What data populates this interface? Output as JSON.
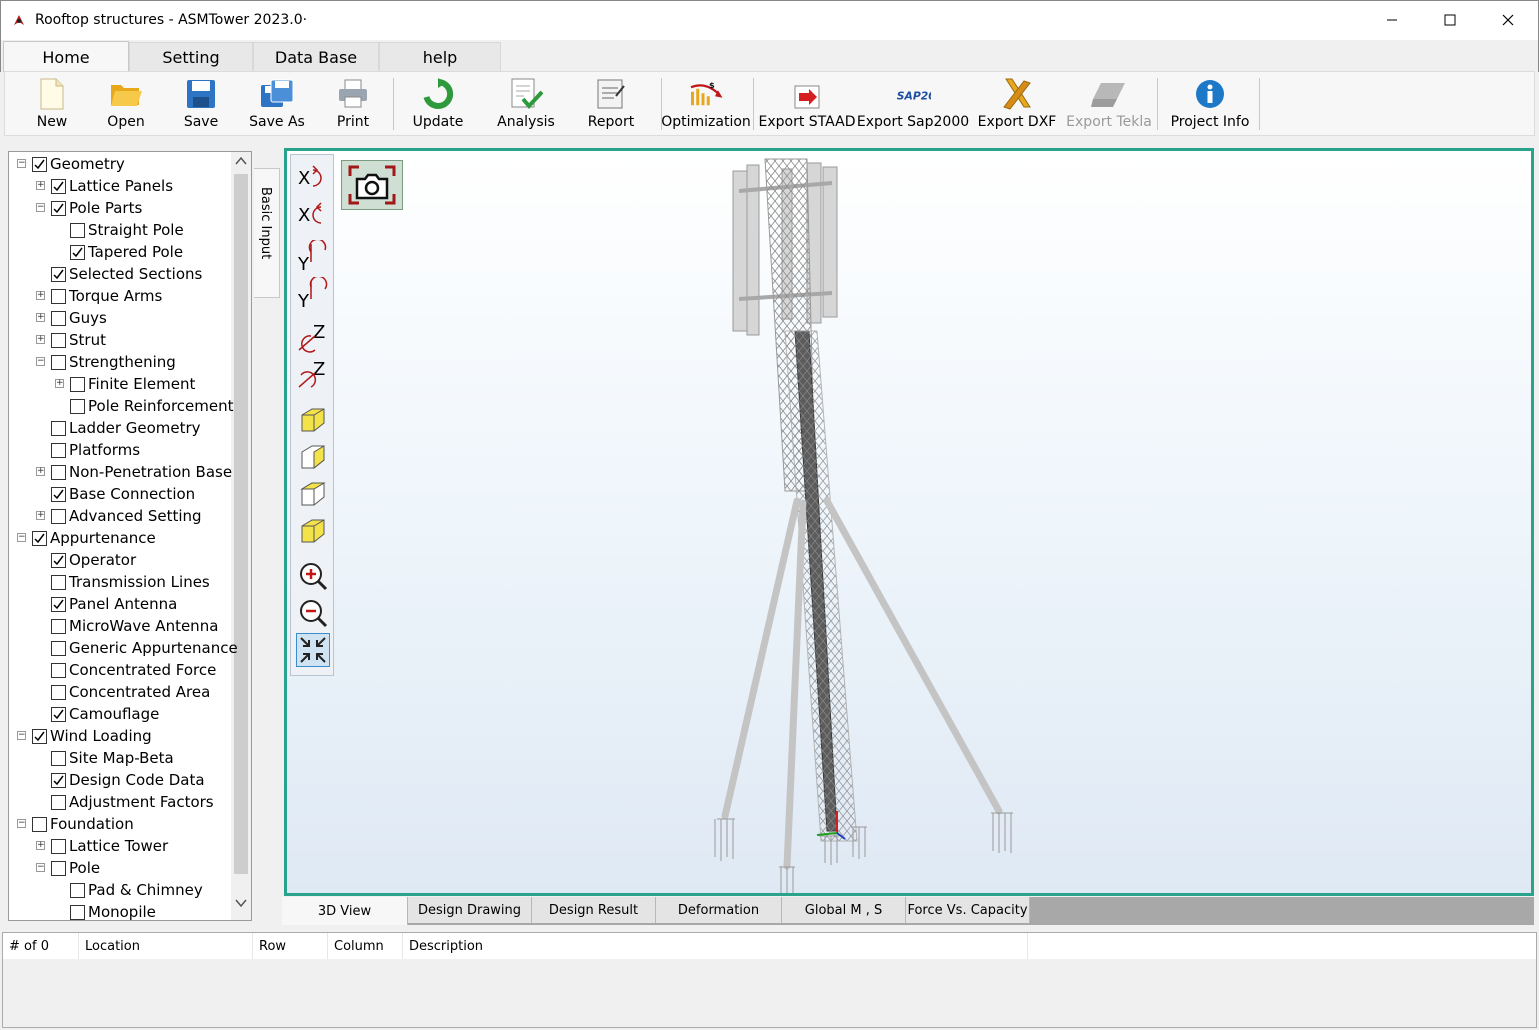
{
  "window": {
    "title": "Rooftop structures - ASMTower 2023.0·"
  },
  "tabs": [
    {
      "label": "Home",
      "active": true
    },
    {
      "label": "Setting"
    },
    {
      "label": "Data Base"
    },
    {
      "label": "help"
    }
  ],
  "ribbon": {
    "new": "New",
    "open": "Open",
    "save": "Save",
    "save_as": "Save As",
    "print": "Print",
    "update": "Update",
    "analysis": "Analysis",
    "report": "Report",
    "optimization": "Optimization",
    "export_staad": "Export STAAD",
    "export_sap": "Export Sap2000",
    "export_dxf": "Export DXF",
    "export_tekla": "Export Tekla",
    "project_info": "Project Info",
    "sap_logo_text": "SAP2000"
  },
  "side_tab": "Basic Input",
  "tree": [
    {
      "label": "Geometry",
      "checked": true,
      "exp": "-"
    },
    {
      "label": "Lattice Panels",
      "checked": true,
      "exp": "+"
    },
    {
      "label": "Pole Parts",
      "checked": true,
      "exp": "-"
    },
    {
      "label": "Straight Pole",
      "checked": false
    },
    {
      "label": "Tapered Pole",
      "checked": true
    },
    {
      "label": "Selected Sections",
      "checked": true
    },
    {
      "label": "Torque Arms",
      "checked": false,
      "exp": "+"
    },
    {
      "label": "Guys",
      "checked": false,
      "exp": "+"
    },
    {
      "label": "Strut",
      "checked": false,
      "exp": "+"
    },
    {
      "label": "Strengthening",
      "checked": false,
      "exp": "-"
    },
    {
      "label": "Finite Element",
      "checked": false,
      "exp": "+"
    },
    {
      "label": "Pole Reinforcement",
      "checked": false
    },
    {
      "label": "Ladder Geometry",
      "checked": false
    },
    {
      "label": "Platforms",
      "checked": false
    },
    {
      "label": "Non-Penetration Base",
      "checked": false,
      "exp": "+"
    },
    {
      "label": "Base Connection",
      "checked": true
    },
    {
      "label": "Advanced Setting",
      "checked": false,
      "exp": "+"
    },
    {
      "label": "Appurtenance",
      "checked": true,
      "exp": "-"
    },
    {
      "label": "Operator",
      "checked": true
    },
    {
      "label": "Transmission Lines",
      "checked": false
    },
    {
      "label": "Panel Antenna",
      "checked": true
    },
    {
      "label": "MicroWave Antenna",
      "checked": false
    },
    {
      "label": "Generic Appurtenance",
      "checked": false
    },
    {
      "label": "Concentrated Force",
      "checked": false
    },
    {
      "label": "Concentrated Area",
      "checked": false
    },
    {
      "label": "Camouflage",
      "checked": true
    },
    {
      "label": "Wind Loading",
      "checked": true,
      "exp": "-"
    },
    {
      "label": "Site Map-Beta",
      "checked": false
    },
    {
      "label": "Design Code Data",
      "checked": true
    },
    {
      "label": "Adjustment Factors",
      "checked": false
    },
    {
      "label": "Foundation",
      "checked": false,
      "exp": "-"
    },
    {
      "label": "Lattice Tower",
      "checked": false,
      "exp": "+"
    },
    {
      "label": "Pole",
      "checked": false,
      "exp": "-"
    },
    {
      "label": "Pad & Chimney",
      "checked": false
    },
    {
      "label": "Monopile",
      "checked": false
    }
  ],
  "view_toolbar": {
    "x_label": "X",
    "y_label": "Y",
    "z_label": "Z"
  },
  "bottom_tabs": [
    {
      "label": "3D View",
      "active": true
    },
    {
      "label": "Design Drawing"
    },
    {
      "label": "Design Result"
    },
    {
      "label": "Deformation"
    },
    {
      "label": "Global M , S"
    },
    {
      "label": "Force Vs. Capacity"
    }
  ],
  "grid": {
    "columns": [
      "# of 0",
      "Location",
      "Row",
      "Column",
      "Description"
    ]
  },
  "colors": {
    "viewport_border": "#2aa38d",
    "accent_blue": "#1e78c8"
  }
}
